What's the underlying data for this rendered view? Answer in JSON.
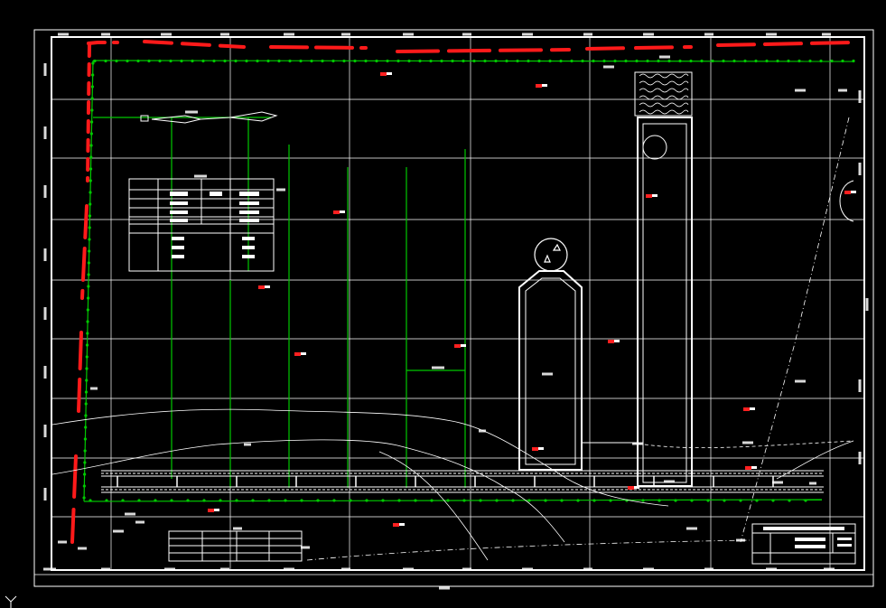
{
  "drawing": {
    "scale_label": "",
    "north_arrow_label": "",
    "map_label": ""
  },
  "colors": {
    "background": "#000000",
    "frame": "#ffffff",
    "grid": "#ffffff",
    "green_line": "#00c800",
    "red_boundary": "#ff1a1a",
    "markers": "#ff2020"
  },
  "icons": {
    "north_arrow": "north-arrow-icon",
    "well_symbol": "triangle-circle-icon",
    "cursor": "crosshair-icon"
  }
}
